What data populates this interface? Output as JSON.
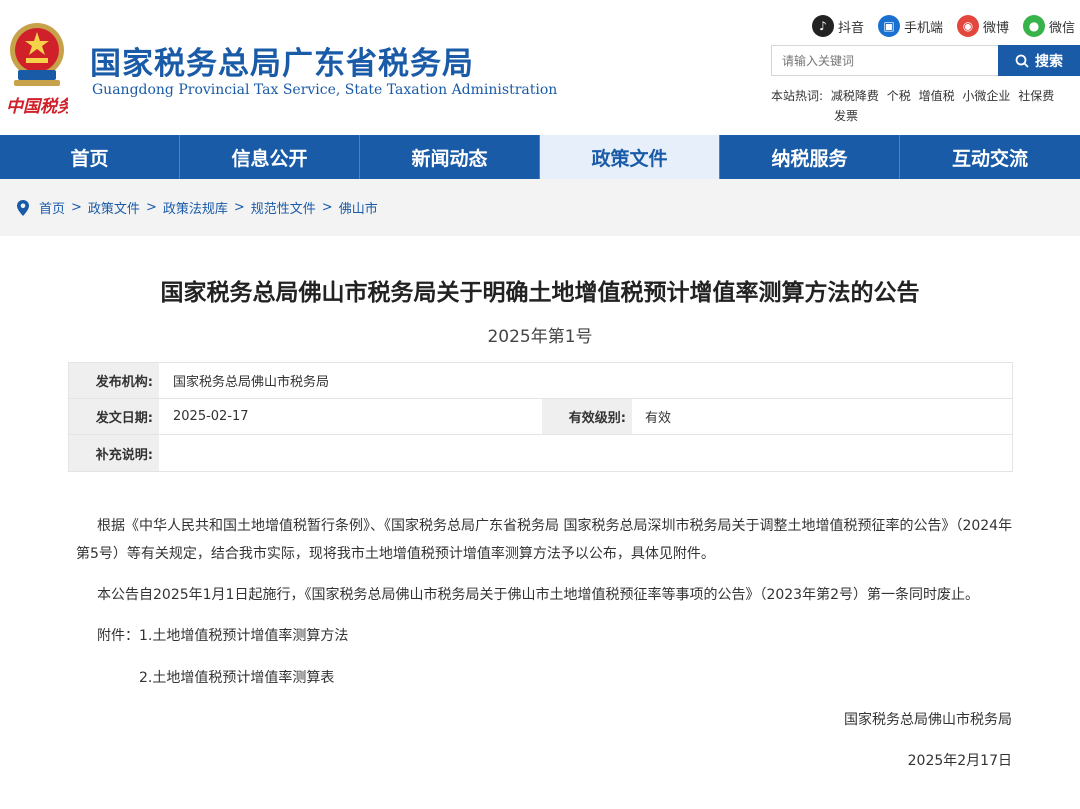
{
  "header": {
    "site_title": "国家税务总局广东省税务局",
    "site_subtitle": "Guangdong Provincial Tax Service, State Taxation Administration",
    "logo_text": "中国税务",
    "social": [
      {
        "label": "抖音",
        "icon": "douyin-icon"
      },
      {
        "label": "手机端",
        "icon": "mobile-icon"
      },
      {
        "label": "微博",
        "icon": "weibo-icon"
      },
      {
        "label": "微信",
        "icon": "wechat-icon"
      }
    ],
    "search": {
      "placeholder": "请输入关键词",
      "button_label": "搜索"
    },
    "hot": {
      "label": "本站热词:",
      "items": [
        "减税降费",
        "个税",
        "增值税",
        "小微企业",
        "社保费",
        "发票"
      ]
    }
  },
  "nav": {
    "items": [
      "首页",
      "信息公开",
      "新闻动态",
      "政策文件",
      "纳税服务",
      "互动交流"
    ],
    "active_index": 3
  },
  "breadcrumb": {
    "items": [
      "首页",
      "政策文件",
      "政策法规库",
      "规范性文件",
      "佛山市"
    ],
    "separator": ">"
  },
  "article": {
    "title": "国家税务总局佛山市税务局关于明确土地增值税预计增值率测算方法的公告",
    "doc_number": "2025年第1号",
    "meta": {
      "publisher_label": "发布机构:",
      "publisher": "国家税务总局佛山市税务局",
      "date_label": "发文日期:",
      "date": "2025-02-17",
      "level_label": "有效级别:",
      "level": "有效",
      "note_label": "补充说明:",
      "note": ""
    },
    "paragraphs": [
      "根据《中华人民共和国土地增值税暂行条例》、《国家税务总局广东省税务局 国家税务总局深圳市税务局关于调整土地增值税预征率的公告》（2024年第5号）等有关规定，结合我市实际，现将我市土地增值税预计增值率测算方法予以公布，具体见附件。",
      "本公告自2025年1月1日起施行，《国家税务总局佛山市税务局关于佛山市土地增值税预征率等事项的公告》（2023年第2号）第一条同时废止。",
      "附件：1.土地增值税预计增值率测算方法",
      "2.土地增值税预计增值率测算表"
    ],
    "signature_org": "国家税务总局佛山市税务局",
    "signature_date": "2025年2月17日"
  },
  "colors": {
    "brand_blue": "#1a5ba8",
    "nav_active_bg": "#e7f0fa",
    "breadcrumb_bg": "#f3f3f3"
  }
}
